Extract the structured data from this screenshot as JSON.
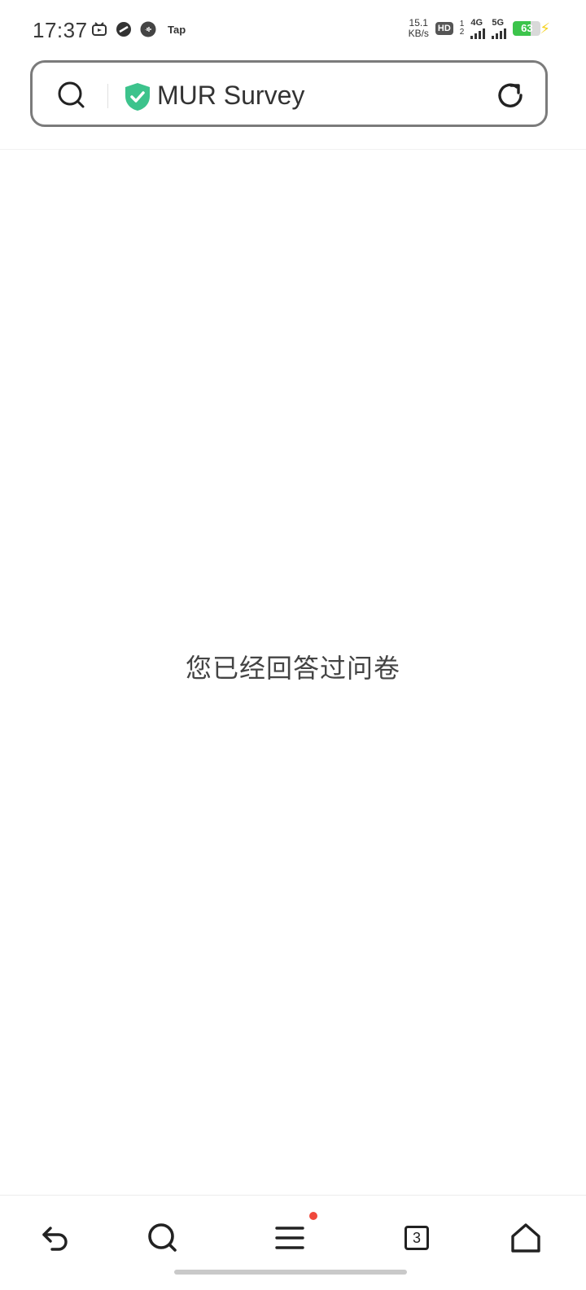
{
  "status_bar": {
    "time": "17:37",
    "tap_label": "Tap",
    "net_speed_value": "15.1",
    "net_speed_unit": "KB/s",
    "hd_label": "HD",
    "sim1": "1",
    "sim2": "2",
    "net_4g": "4G",
    "net_5g": "5G",
    "battery_level": "63",
    "battery_fraction": 0.63
  },
  "address_bar": {
    "title": "MUR Survey"
  },
  "main": {
    "message": "您已经回答过问卷"
  },
  "toolbar": {
    "tabs_count": "3"
  },
  "colors": {
    "shield": "#3cc38c",
    "battery": "#3cc44b",
    "notification_dot": "#f0483c"
  }
}
